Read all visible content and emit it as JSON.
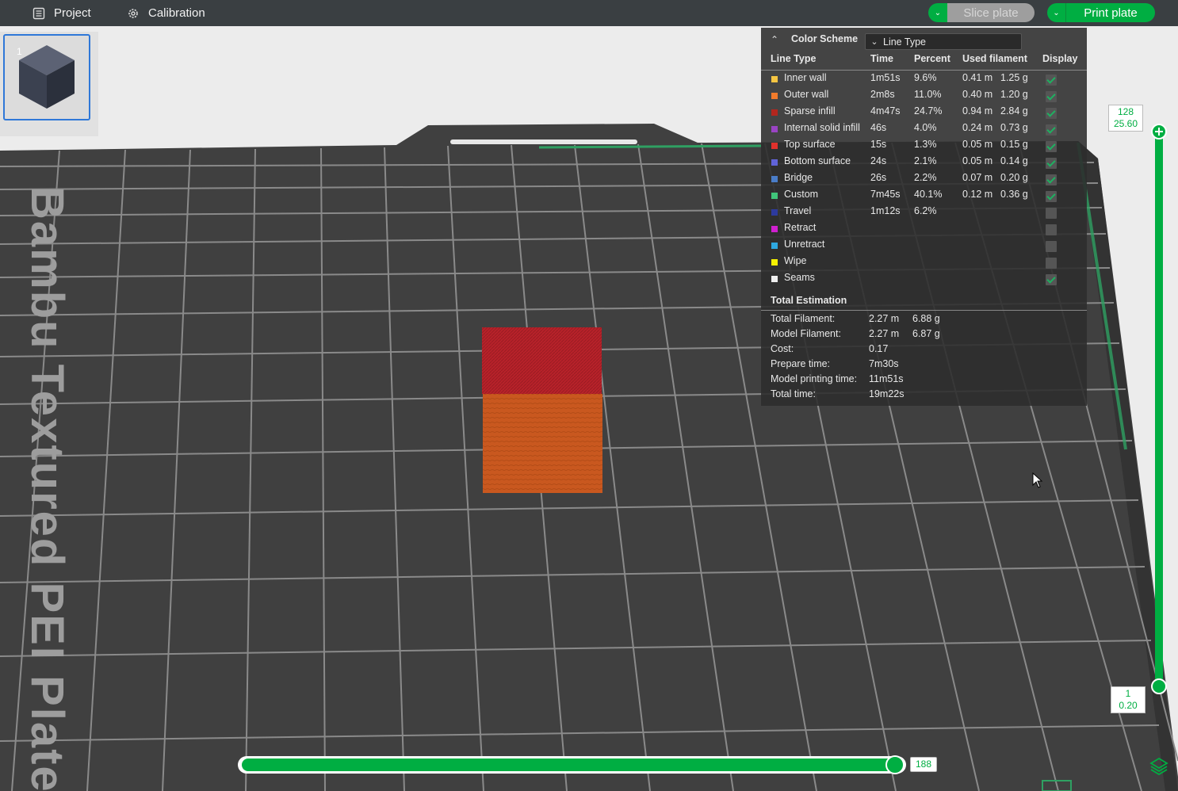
{
  "topbar": {
    "project_label": "Project",
    "calibration_label": "Calibration",
    "slice_label": "Slice plate",
    "print_label": "Print plate"
  },
  "plate": {
    "thumbnail_number": "1",
    "bed_text": "Bambu Textured PEI Plate"
  },
  "legend": {
    "title": "Color Scheme",
    "scheme_value": "Line Type",
    "columns": [
      "Line Type",
      "Time",
      "Percent",
      "Used filament",
      "Display"
    ],
    "rows": [
      {
        "color": "#f5c542",
        "name": "Inner wall",
        "time": "1m51s",
        "percent": "9.6%",
        "meters": "0.41 m",
        "grams": "1.25 g",
        "display": true
      },
      {
        "color": "#f27b2b",
        "name": "Outer wall",
        "time": "2m8s",
        "percent": "11.0%",
        "meters": "0.40 m",
        "grams": "1.20 g",
        "display": true
      },
      {
        "color": "#b3261e",
        "name": "Sparse infill",
        "time": "4m47s",
        "percent": "24.7%",
        "meters": "0.94 m",
        "grams": "2.84 g",
        "display": true
      },
      {
        "color": "#9a44c4",
        "name": "Internal solid infill",
        "time": "46s",
        "percent": "4.0%",
        "meters": "0.24 m",
        "grams": "0.73 g",
        "display": true
      },
      {
        "color": "#e0312c",
        "name": "Top surface",
        "time": "15s",
        "percent": "1.3%",
        "meters": "0.05 m",
        "grams": "0.15 g",
        "display": true
      },
      {
        "color": "#6063d8",
        "name": "Bottom surface",
        "time": "24s",
        "percent": "2.1%",
        "meters": "0.05 m",
        "grams": "0.14 g",
        "display": true
      },
      {
        "color": "#4a7dc8",
        "name": "Bridge",
        "time": "26s",
        "percent": "2.2%",
        "meters": "0.07 m",
        "grams": "0.20 g",
        "display": true
      },
      {
        "color": "#40c57a",
        "name": "Custom",
        "time": "7m45s",
        "percent": "40.1%",
        "meters": "0.12 m",
        "grams": "0.36 g",
        "display": true
      },
      {
        "color": "#2d3a9e",
        "name": "Travel",
        "time": "1m12s",
        "percent": "6.2%",
        "meters": "",
        "grams": "",
        "display": false
      },
      {
        "color": "#d020d0",
        "name": "Retract",
        "time": "",
        "percent": "",
        "meters": "",
        "grams": "",
        "display": false
      },
      {
        "color": "#2ea8e0",
        "name": "Unretract",
        "time": "",
        "percent": "",
        "meters": "",
        "grams": "",
        "display": false
      },
      {
        "color": "#f5f000",
        "name": "Wipe",
        "time": "",
        "percent": "",
        "meters": "",
        "grams": "",
        "display": false
      },
      {
        "color": "#eeeeee",
        "name": "Seams",
        "time": "",
        "percent": "",
        "meters": "",
        "grams": "",
        "display": true
      }
    ],
    "total_title": "Total Estimation",
    "totals": [
      {
        "label": "Total Filament:",
        "v1": "2.27 m",
        "v2": "6.88 g"
      },
      {
        "label": "Model Filament:",
        "v1": "2.27 m",
        "v2": "6.87 g"
      },
      {
        "label": "Cost:",
        "v1": "0.17",
        "v2": ""
      },
      {
        "label": "Prepare time:",
        "v1": "7m30s",
        "v2": ""
      },
      {
        "label": "Model printing time:",
        "v1": "11m51s",
        "v2": ""
      },
      {
        "label": "Total time:",
        "v1": "19m22s",
        "v2": ""
      }
    ]
  },
  "vslider": {
    "top_layer": "128",
    "top_height": "25.60",
    "bottom_layer": "1",
    "bottom_height": "0.20"
  },
  "hslider": {
    "value": "188",
    "fraction": 1.0
  },
  "colors": {
    "accent": "#00ae42",
    "selection": "#2f78d8",
    "model_top": "#b8222a",
    "model_side": "#c9581f"
  }
}
